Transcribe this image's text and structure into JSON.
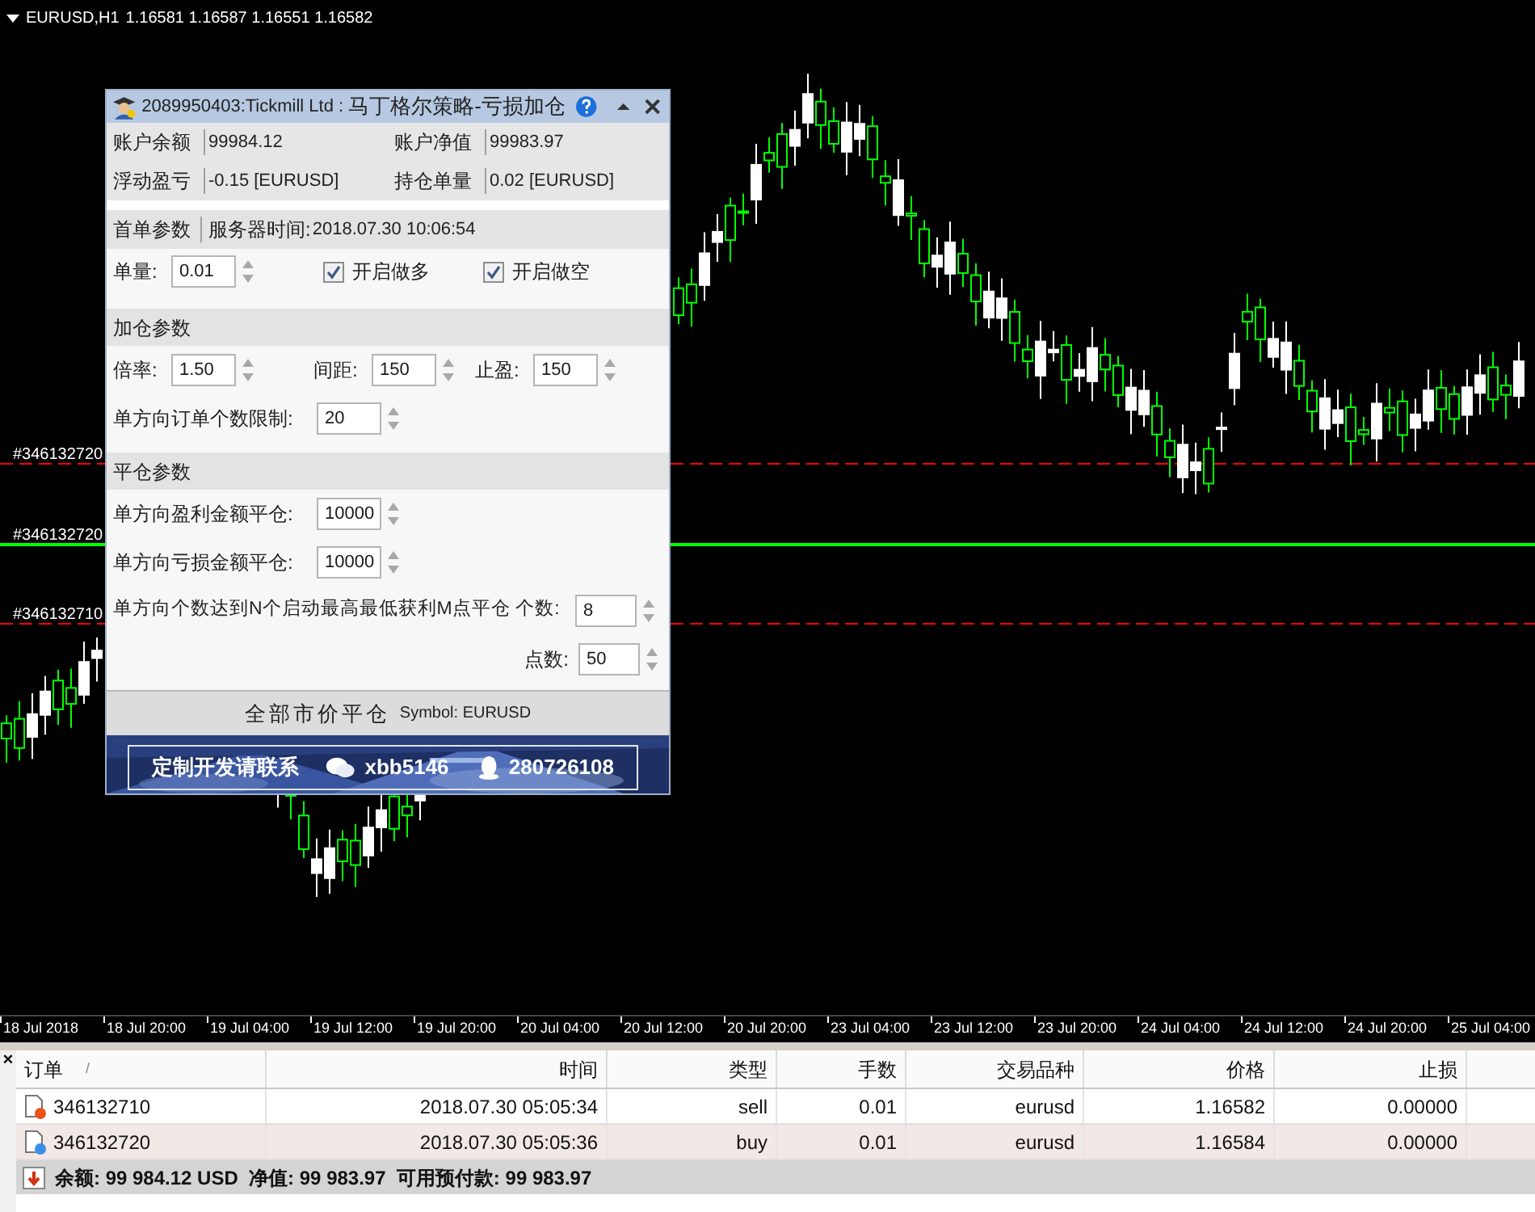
{
  "chart": {
    "symbol": "EURUSD,H1",
    "prices": "1.16581 1.16587 1.16551 1.16582",
    "order_lines": [
      {
        "label": "#346132720",
        "color": "#ff0000",
        "kind": "dashed"
      },
      {
        "label": "#346132720",
        "color": "#00ff00",
        "kind": "solid"
      },
      {
        "label": "#346132710",
        "color": "#ff0000",
        "kind": "dashed"
      }
    ],
    "time_axis": [
      "18 Jul 2018",
      "18 Jul 20:00",
      "19 Jul 04:00",
      "19 Jul 12:00",
      "19 Jul 20:00",
      "20 Jul 04:00",
      "20 Jul 12:00",
      "20 Jul 20:00",
      "23 Jul 04:00",
      "23 Jul 12:00",
      "23 Jul 20:00",
      "24 Jul 04:00",
      "24 Jul 12:00",
      "24 Jul 20:00",
      "25 Jul 04:00"
    ]
  },
  "panel": {
    "account": "2089950403:Tickmill Ltd :",
    "title": "马丁格尔策略-亏损加仓",
    "info": [
      [
        {
          "label": "账户余额",
          "value": "99984.12"
        },
        {
          "label": "账户净值",
          "value": "99983.97"
        }
      ],
      [
        {
          "label": "浮动盈亏",
          "value": "-0.15  [EURUSD]"
        },
        {
          "label": "持仓单量",
          "value": "0.02  [EURUSD]"
        }
      ]
    ],
    "first": {
      "heading": "首单参数",
      "server_label": "服务器时间:",
      "server_time": "2018.07.30 10:06:54",
      "lot_label": "单量:",
      "lot": "0.01",
      "checks": [
        {
          "label": "开启做多",
          "checked": true
        },
        {
          "label": "开启做空",
          "checked": true
        }
      ]
    },
    "add": {
      "heading": "加仓参数",
      "fields": [
        {
          "label": "倍率:",
          "value": "1.50"
        },
        {
          "label": "间距:",
          "value": "150"
        },
        {
          "label": "止盈:",
          "value": "150"
        }
      ],
      "limit": {
        "label": "单方向订单个数限制:",
        "value": "20"
      }
    },
    "close": {
      "heading": "平仓参数",
      "rows": [
        {
          "label": "单方向盈利金额平仓:",
          "value": "10000",
          "kind": "left"
        },
        {
          "label": "单方向亏损金额平仓:",
          "value": "10000",
          "kind": "left"
        },
        {
          "label": "单方向个数达到N个启动最高最低获利M点平仓 个数:",
          "value": "8",
          "kind": "wide"
        },
        {
          "label": "点数:",
          "value": "50",
          "kind": "right"
        }
      ]
    },
    "button": "全部市价平仓",
    "symbol": "Symbol: EURUSD",
    "banner": {
      "text": "定制开发请联系",
      "wechat": "xbb5146",
      "qq": "280726108"
    }
  },
  "terminal": {
    "close": "×",
    "sort_mark": "/",
    "columns": [
      "订单",
      "时间",
      "类型",
      "手数",
      "交易品种",
      "价格",
      "止损"
    ],
    "rows": [
      {
        "cells": [
          "346132710",
          "2018.07.30 05:05:34",
          "sell",
          "0.01",
          "eurusd",
          "1.16582",
          "0.00000"
        ],
        "color": "#e8541a",
        "selected": false
      },
      {
        "cells": [
          "346132720",
          "2018.07.30 05:05:36",
          "buy",
          "0.01",
          "eurusd",
          "1.16584",
          "0.00000"
        ],
        "color": "#3a8ee6",
        "selected": true
      }
    ],
    "summary": "余额: 99 984.12 USD  净值: 99 983.97  可用预付款: 99 983.97"
  }
}
